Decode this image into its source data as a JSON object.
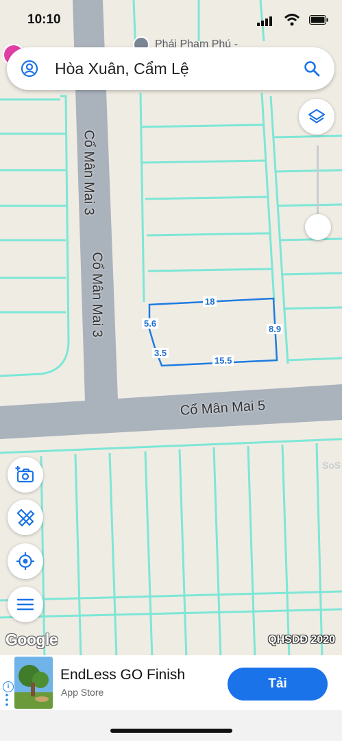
{
  "status_bar": {
    "time": "10:10"
  },
  "map": {
    "poi_label": "Phái Phạm Phú -",
    "road_labels": [
      "Cổ Mân Mai 3",
      "Cổ Mân Mai 3",
      "Cổ Mân Mai 5"
    ],
    "parcel_dims": [
      "18",
      "5.6",
      "8.9",
      "3.5",
      "15.5"
    ],
    "watermark": "SoS",
    "google": "Google",
    "plan_label": "QHSDĐ 2020"
  },
  "search": {
    "value": "Hòa Xuân, Cẩm Lệ"
  },
  "ad": {
    "title": "EndLess GO Finish",
    "subtitle": "App Store",
    "cta": "Tải"
  },
  "colors": {
    "accent": "#1a73e8",
    "parcel": "#6fe3d0",
    "road": "#aab2bc",
    "measure": "#1e7be0"
  }
}
